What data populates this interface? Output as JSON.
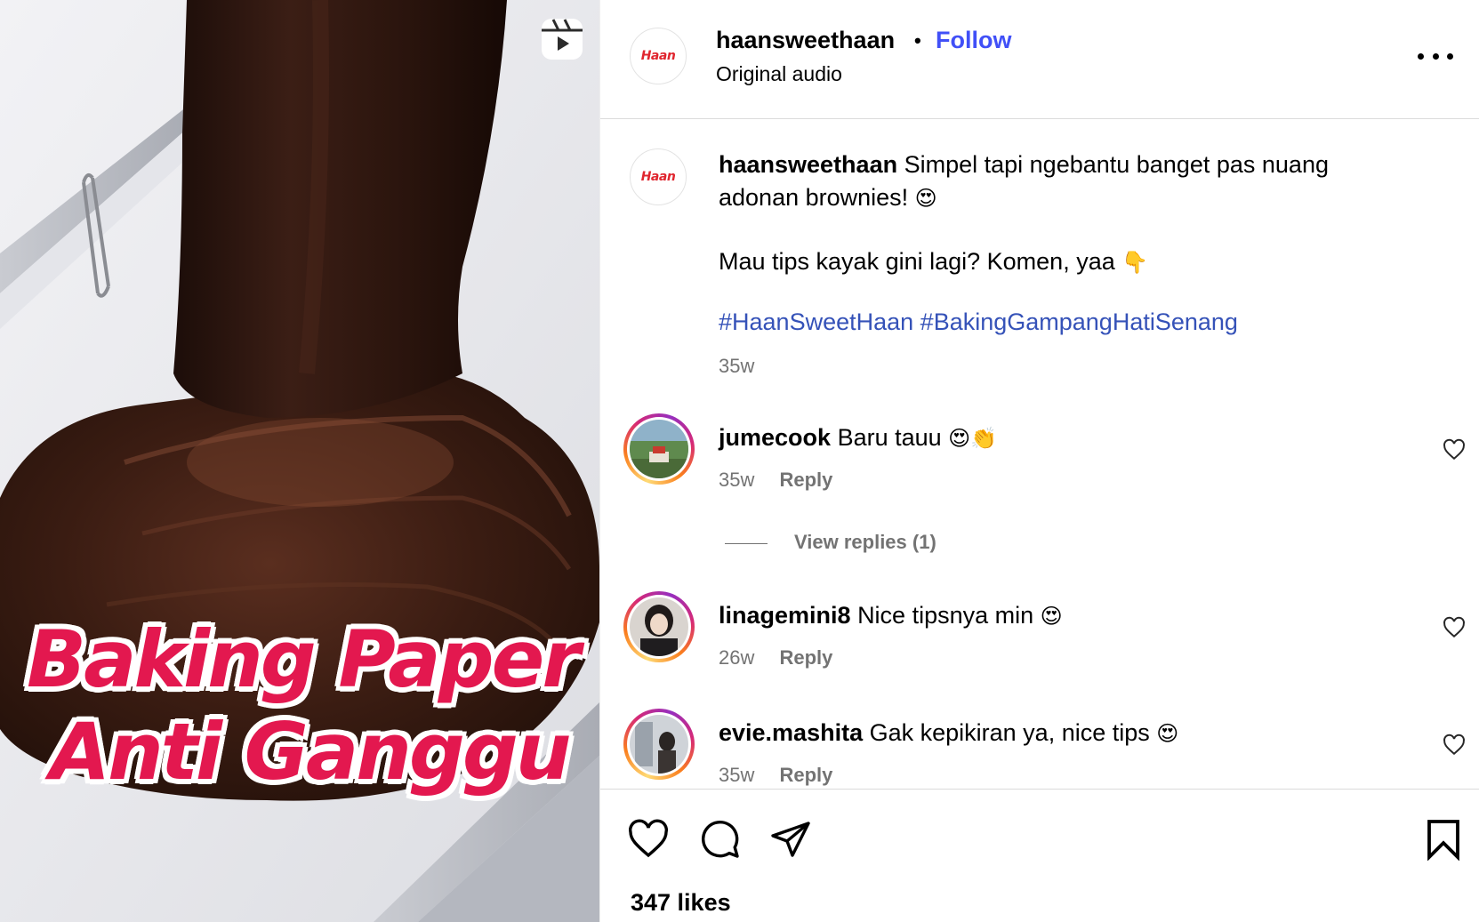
{
  "media": {
    "overlay_line1": "Baking Paper",
    "overlay_line2": "Anti Ganggu",
    "badge_icon": "reels-icon",
    "colors": {
      "overlay_text": "#e3184f",
      "chocolate": "#3a1d14"
    }
  },
  "header": {
    "avatar_logo": "Haan",
    "username": "haansweethaan",
    "separator": "•",
    "follow_label": "Follow",
    "subtitle": "Original audio",
    "more_icon": "more-options-icon"
  },
  "caption": {
    "avatar_logo": "Haan",
    "username": "haansweethaan",
    "text": "Simpel tapi ngebantu banget pas nuang adonan brownies!",
    "emoji1": "😍",
    "line2": "Mau tips kayak gini lagi? Komen, yaa",
    "emoji2": "👇",
    "hashtag1": "#HaanSweetHaan",
    "hashtag2": "#BakingGampangHatiSenang",
    "time": "35w"
  },
  "comments": [
    {
      "username": "jumecook",
      "text": "Baru tauu",
      "emoji": "😍👏",
      "time": "35w",
      "reply_label": "Reply"
    },
    {
      "username": "linagemini8",
      "text": "Nice tipsnya min",
      "emoji": "😍",
      "time": "26w",
      "reply_label": "Reply"
    },
    {
      "username": "evie.mashita",
      "text": "Gak kepikiran ya, nice tips",
      "emoji": "😍",
      "time": "35w",
      "reply_label": "Reply"
    }
  ],
  "view_replies_label": "View replies (1)",
  "actions": {
    "like_icon": "heart-icon",
    "comment_icon": "comment-icon",
    "share_icon": "share-icon",
    "save_icon": "bookmark-icon",
    "likes": "347 likes"
  },
  "colors": {
    "follow": "#4150f7",
    "hashtag": "#3552b8",
    "muted": "#737373",
    "ring": "#d62976"
  }
}
